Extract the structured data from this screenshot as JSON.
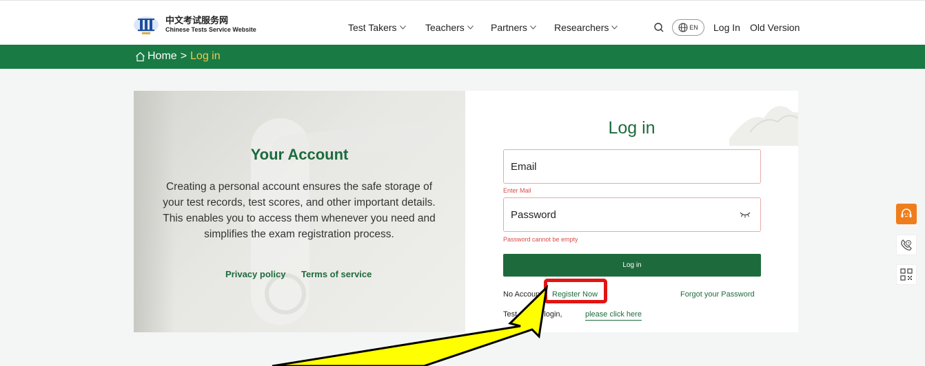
{
  "header": {
    "logo_cn": "中文考试服务网",
    "logo_en": "Chinese Tests Service Website",
    "nav": [
      {
        "label": "Test Takers"
      },
      {
        "label": "Teachers"
      },
      {
        "label": "Partners"
      },
      {
        "label": "Researchers"
      }
    ],
    "language": "EN",
    "login": "Log In",
    "old_version": "Old Version"
  },
  "breadcrumb": {
    "home": "Home",
    "separator": ">",
    "current": "Log in"
  },
  "info_panel": {
    "title": "Your Account",
    "description": "Creating a personal account ensures the safe storage of your test records, test scores, and other important details. This enables you to access them whenever you need and simplifies the exam registration process.",
    "privacy": "Privacy policy",
    "terms": "Terms of service"
  },
  "login_form": {
    "title": "Log in",
    "email_label": "Email",
    "email_error": "Enter Mail",
    "password_label": "Password",
    "password_error": "Password cannot be empty",
    "submit": "Log in",
    "no_account": "No Account",
    "register": "Register Now",
    "forgot": "Forgot your Password",
    "center_prefix": "Test Center login,",
    "center_link": "please click here"
  },
  "colors": {
    "brand_green": "#197a44",
    "accent_yellow": "#f2c94c",
    "error_red": "#d94b4b",
    "highlight_red": "#e21414",
    "arrow_yellow": "#ffff00"
  }
}
